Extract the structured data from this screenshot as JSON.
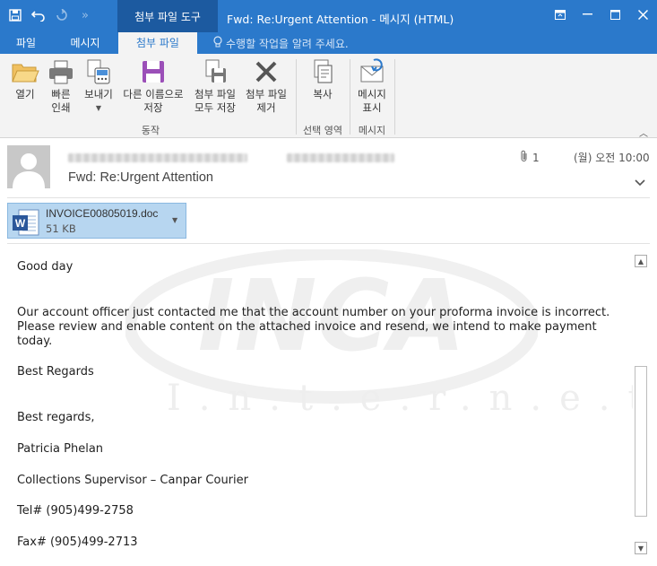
{
  "window": {
    "context_tab": "첨부 파일 도구",
    "title": "Fwd: Re:Urgent Attention - 메시지 (HTML)"
  },
  "tabs": [
    {
      "label": "파일"
    },
    {
      "label": "메시지"
    },
    {
      "label": "첨부 파일"
    }
  ],
  "tell_me": "수행할 작업을 알려 주세요.",
  "ribbon": {
    "open": "열기",
    "quick_print_1": "빠른",
    "quick_print_2": "인쇄",
    "save_as": "보내기",
    "remove_save_1": "다른 이름으로",
    "remove_save_2": "저장",
    "save_all_1": "첨부 파일",
    "save_all_2": "모두 저장",
    "remove_1": "첨부 파일",
    "remove_2": "제거",
    "copy": "복사",
    "show_message_1": "메시지",
    "show_message_2": "표시",
    "group_actions": "동작",
    "group_selection": "선택 영역",
    "group_message": "메시지"
  },
  "header": {
    "subject": "Fwd: Re:Urgent Attention",
    "attachment_count": "1",
    "datetime": "(월) 오전 10:00"
  },
  "attachment": {
    "name": "INVOICE00805019.doc",
    "size": "51 KB"
  },
  "body": {
    "greeting": "Good day",
    "paragraph": "Our account officer just contacted me that the account number on your proforma invoice is incorrect. Please review and enable content on the attached invoice and resend, we intend to make payment today.",
    "best_regards_1": "Best Regards",
    "best_regards_2": "Best regards,",
    "name": "Patricia Phelan",
    "title": "Collections Supervisor – Canpar Courier",
    "tel": "Tel# (905)499-2758",
    "fax": "Fax# (905)499-2713"
  },
  "watermark": {
    "brand": "INCA",
    "tagline": "I.n.t.e.r.n.e.t"
  },
  "icons": {
    "save": "save-icon",
    "undo": "undo-icon",
    "redo": "redo-icon",
    "attachment": "paperclip-icon",
    "word_doc": "word-document-icon"
  },
  "colors": {
    "accent": "#2b79cb",
    "context_tab": "#1c5aa0",
    "attachment_bg": "#b7d6f0"
  }
}
